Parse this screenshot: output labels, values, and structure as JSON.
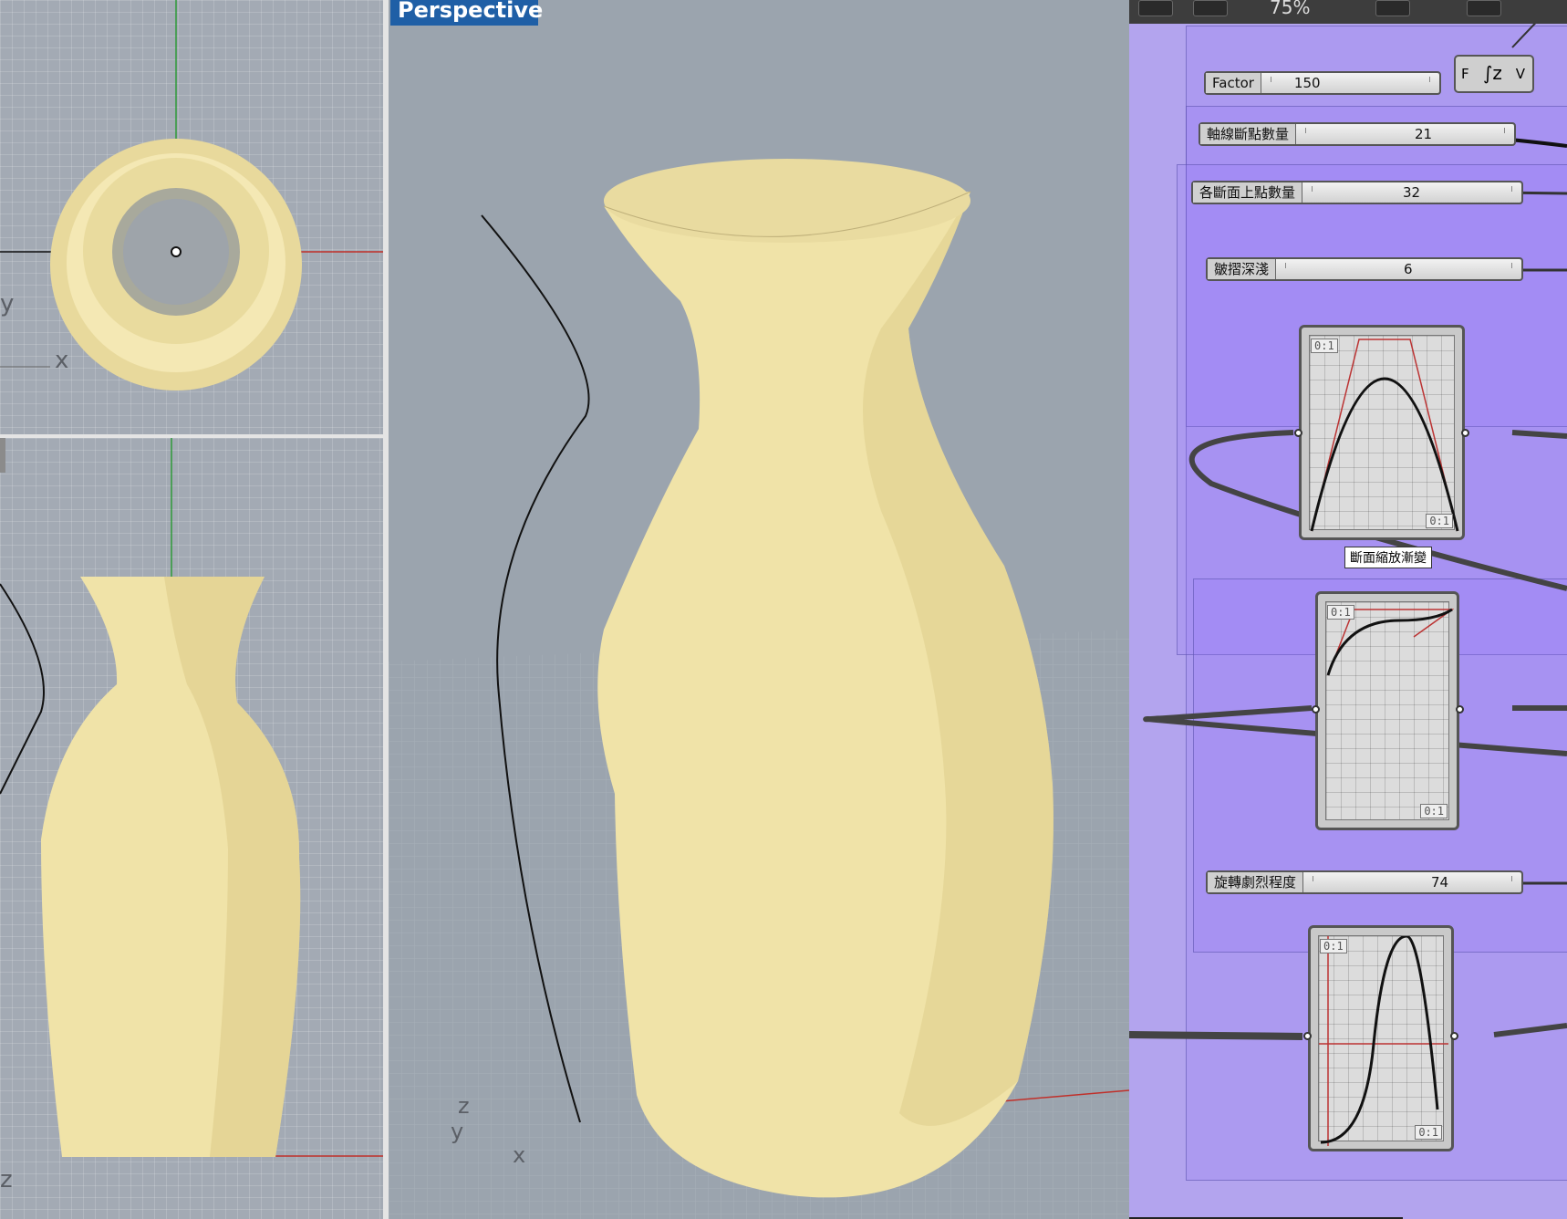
{
  "viewports": {
    "top": {
      "axis_y": "y",
      "axis_x": "x"
    },
    "front": {
      "axis_z": "z"
    },
    "perspective": {
      "label": "Perspective",
      "axis_z": "z",
      "axis_y": "y",
      "axis_x": "x"
    }
  },
  "grasshopper": {
    "toolbar": {
      "zoom": "75%"
    },
    "factor": {
      "label": "Factor",
      "value": "150"
    },
    "fv_node": {
      "input": "F",
      "output": "V"
    },
    "sliders": [
      {
        "label": "軸線斷點數量",
        "value": "21"
      },
      {
        "label": "各斷面上點數量",
        "value": "32"
      },
      {
        "label": "皺摺深淺",
        "value": "6"
      },
      {
        "label": "旋轉劇烈程度",
        "value": "74"
      }
    ],
    "graph_tooltip": "斷面縮放漸變",
    "graph_domain": "0:1"
  },
  "colors": {
    "vase": "#f1e5ad",
    "viewport_bg": "#9ba4ae",
    "perspective_tag": "#1f5fa6",
    "canvas_bg": "#b3a4ee"
  }
}
